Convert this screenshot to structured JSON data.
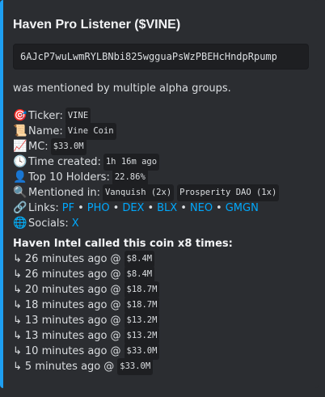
{
  "embed": {
    "title": "Haven Pro Listener ($VINE)",
    "address": "6AJcP7wuLwmRYLBNbi825wgguaPsWzPBEHcHndpRpump",
    "mention_text": "was mentioned by multiple alpha groups.",
    "accent_color": "#1e9ff2"
  },
  "fields": {
    "ticker": {
      "icon": "target-icon",
      "glyph": "🎯",
      "label": "Ticker:",
      "value": "VINE"
    },
    "name": {
      "icon": "scroll-icon",
      "glyph": "📜",
      "label": "Name:",
      "value": "Vine Coin"
    },
    "mc": {
      "icon": "chart-increasing-icon",
      "glyph": "📈",
      "label": "MC:",
      "value": "$33.0M"
    },
    "time_created": {
      "icon": "clock-icon",
      "glyph": "🕓",
      "label": "Time created:",
      "value": "1h 16m ago"
    },
    "top_holders": {
      "icon": "person-silhouette-icon",
      "glyph": "👤",
      "label": "Top 10 Holders:",
      "value": "22.86%"
    },
    "mentioned_in": {
      "icon": "magnifier-icon",
      "glyph": "🔍",
      "label": "Mentioned in:",
      "values": [
        "Vanquish (2x)",
        "Prosperity DAO (1x)"
      ]
    },
    "links": {
      "icon": "link-icon",
      "glyph": "🔗",
      "label": "Links:",
      "items": [
        "PF",
        "PHO",
        "DEX",
        "BLX",
        "NEO",
        "GMGN"
      ],
      "separator": "•"
    },
    "socials": {
      "icon": "globe-icon",
      "glyph": "🌐",
      "label": "Socials:",
      "items": [
        "X"
      ]
    }
  },
  "calls": {
    "title": "Haven Intel called this coin x8 times:",
    "arrow": "↳",
    "at": "@",
    "items": [
      {
        "time": "26 minutes ago",
        "mc": "$8.4M"
      },
      {
        "time": "26 minutes ago",
        "mc": "$8.4M"
      },
      {
        "time": "20 minutes ago",
        "mc": "$18.7M"
      },
      {
        "time": "18 minutes ago",
        "mc": "$18.7M"
      },
      {
        "time": "13 minutes ago",
        "mc": "$13.2M"
      },
      {
        "time": "13 minutes ago",
        "mc": "$13.2M"
      },
      {
        "time": "10 minutes ago",
        "mc": "$33.0M"
      },
      {
        "time": "5 minutes ago",
        "mc": "$33.0M"
      }
    ]
  }
}
